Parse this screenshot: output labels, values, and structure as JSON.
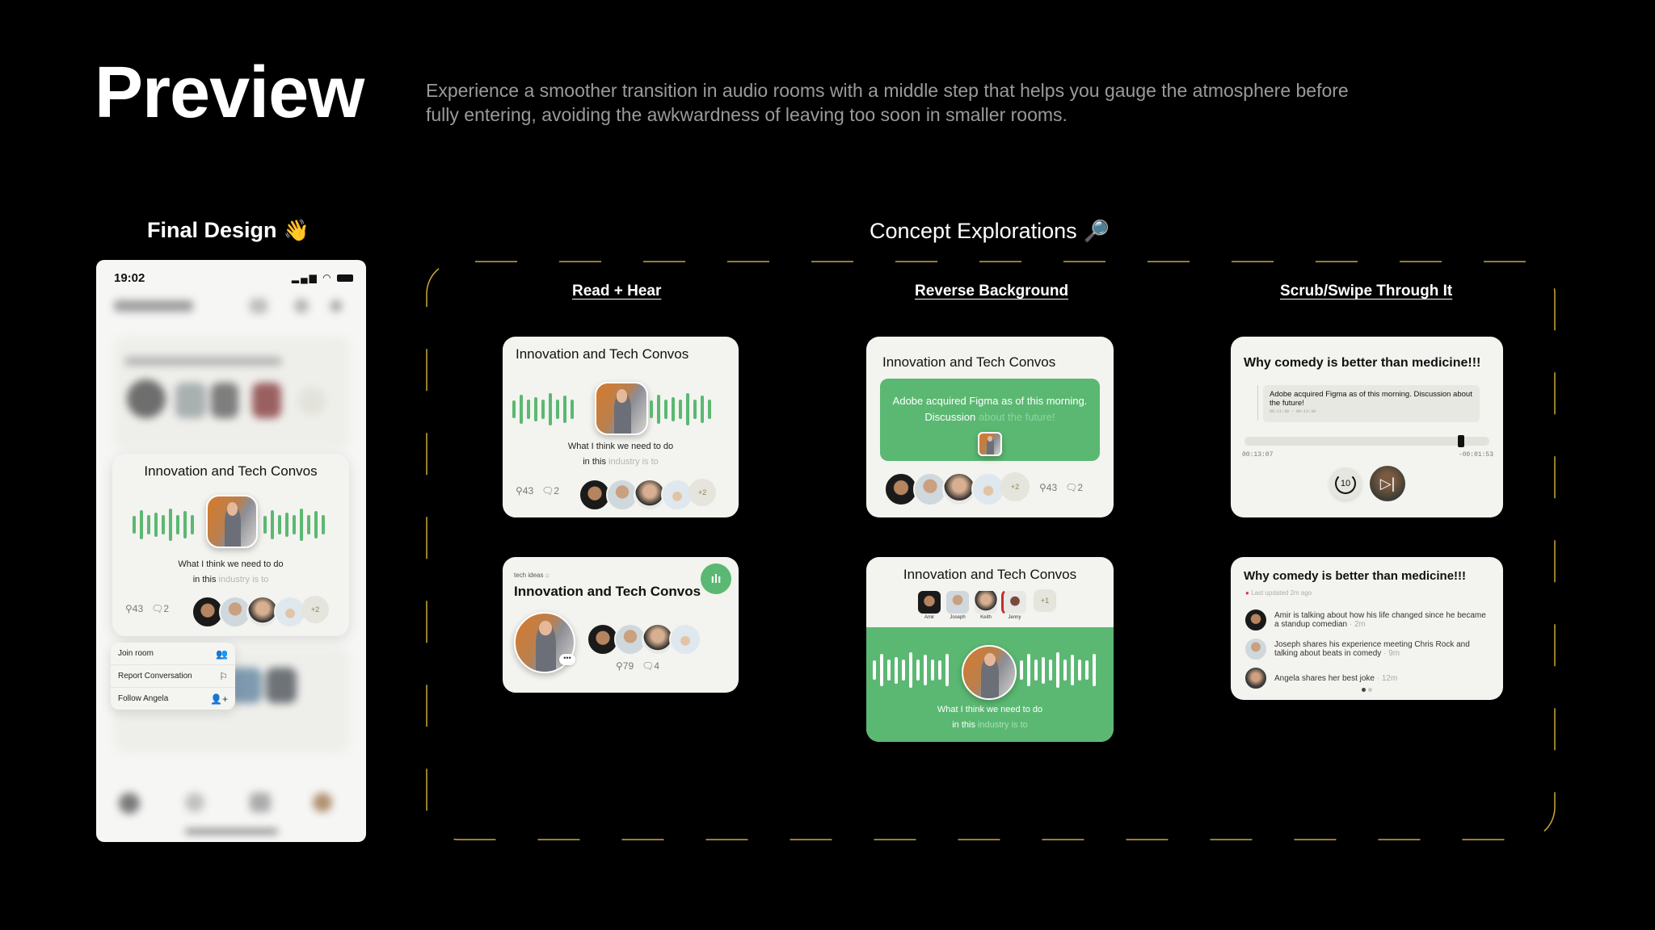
{
  "header": {
    "title": "Preview",
    "subtitle": "Experience a smoother transition in audio rooms with a middle step that helps you gauge the atmosphere before fully entering, avoiding the awkwardness of leaving too soon in smaller rooms."
  },
  "final_design": {
    "label": "Final Design",
    "emoji": "👋",
    "phone": {
      "time": "19:02",
      "status_icons": "signal wifi battery",
      "card": {
        "title": "Innovation and Tech Convos",
        "quote_line1": "What I think we need to do",
        "quote_line2_bold": "in this",
        "quote_line2_dim": "industry is to",
        "listeners": "43",
        "comments": "2",
        "more_count": "+2"
      },
      "menu": [
        {
          "label": "Join room",
          "icon": "group-icon"
        },
        {
          "label": "Report Conversation",
          "icon": "flag-icon"
        },
        {
          "label": "Follow Angela",
          "icon": "add-user-icon"
        }
      ]
    }
  },
  "concepts": {
    "label": "Concept Explorations",
    "emoji": "🔎",
    "sections": [
      {
        "title": "Read + Hear"
      },
      {
        "title": "Reverse Background"
      },
      {
        "title": "Scrub/Swipe Through It"
      }
    ],
    "read_hear_a": {
      "title": "Innovation and Tech Convos",
      "quote_line1": "What I think we need to do",
      "quote_line2_bold": "in this",
      "quote_line2_dim": "industry is to",
      "listeners": "43",
      "comments": "2",
      "more_count": "+2"
    },
    "read_hear_b": {
      "club": "tech ideas",
      "title": "Innovation and Tech Convos",
      "listeners": "79",
      "comments": "4"
    },
    "reverse_a": {
      "title": "Innovation and Tech Convos",
      "text_bright": "Adobe acquired Figma as of this morning. Discussion",
      "text_dim": "about the future!",
      "listeners": "43",
      "comments": "2",
      "more_count": "+2"
    },
    "reverse_b": {
      "title": "Innovation and Tech Convos",
      "speakers": [
        "Amir",
        "Joseph",
        "Keith",
        "Jenny"
      ],
      "more_count": "+1",
      "quote_line1": "What I think we need to do",
      "quote_line2_bold": "in this",
      "quote_line2_dim": "industry is to"
    },
    "scrub_a": {
      "title": "Why comedy is better than medicine!!!",
      "chapter_text": "Adobe acquired Figma as of this morning. Discussion about the future!",
      "chapter_range": "00:11:30 - 00:13:30",
      "elapsed": "00:13:07",
      "remaining": "-00:01:53",
      "progress_fraction": 0.87,
      "rewind_label": "10"
    },
    "scrub_b": {
      "title": "Why comedy is better than medicine!!!",
      "updated": "Last updated 2m ago",
      "items": [
        {
          "text": "Amir is talking about how his life changed since he became a standup comedian",
          "time": "· 2m"
        },
        {
          "text": "Joseph shares his experience meeting Chris Rock and talking about beats in comedy",
          "time": "· 9m"
        },
        {
          "text": "Angela shares her best joke",
          "time": "· 12m"
        }
      ],
      "page": "1 of 2"
    }
  },
  "colors": {
    "accent_green": "#5bb872",
    "frame_gold": "#c9a93a",
    "card_bg": "#f3f3ef",
    "live_red": "#d33a4a"
  }
}
